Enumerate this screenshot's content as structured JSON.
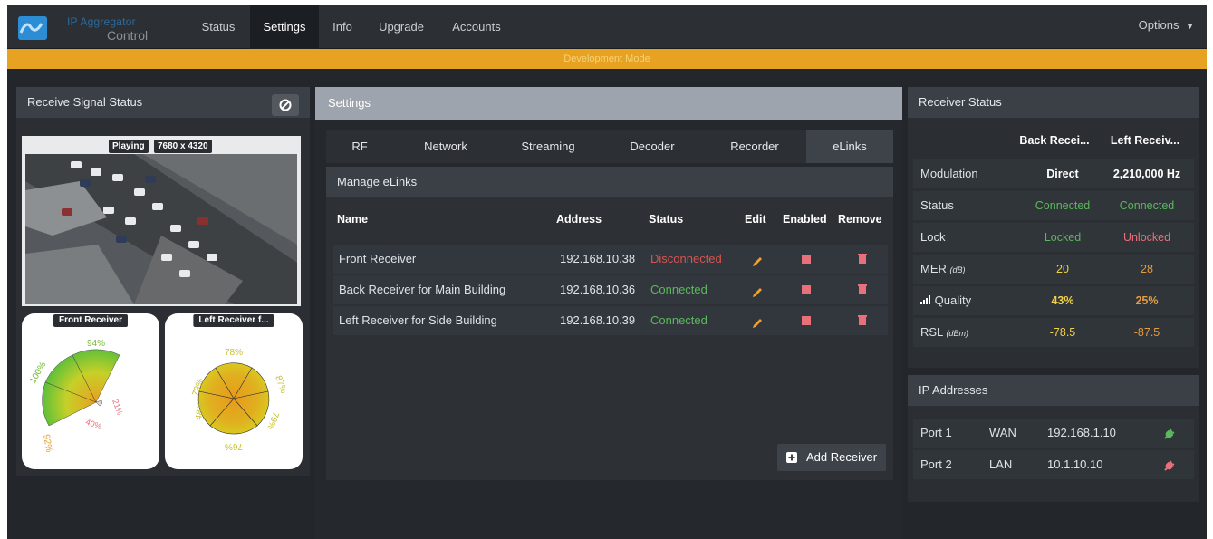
{
  "app": {
    "brand_line1": "IP Aggregator",
    "brand_line2": "Control",
    "nav": [
      "Status",
      "Settings",
      "Info",
      "Upgrade",
      "Accounts"
    ],
    "active_nav": "Settings",
    "options_label": "Options",
    "mode_banner": "Development Mode"
  },
  "receive_signal": {
    "title": "Receive Signal Status",
    "playing_label": "Playing",
    "resolution": "7680 x 4320",
    "cards": [
      {
        "title": "Front Receiver",
        "labels": [
          "94%",
          "100%",
          "21%",
          "40%",
          "92%"
        ]
      },
      {
        "title": "Left Receiver f...",
        "labels": [
          "78%",
          "87%",
          "79%",
          "48%",
          "79%",
          "76%"
        ]
      }
    ]
  },
  "settings": {
    "title": "Settings",
    "tabs": [
      "RF",
      "Network",
      "Streaming",
      "Decoder",
      "Recorder",
      "eLinks"
    ],
    "active_tab": "eLinks",
    "manage_title": "Manage eLinks",
    "columns": [
      "Name",
      "Address",
      "Status",
      "Edit",
      "Enabled",
      "Remove"
    ],
    "rows": [
      {
        "name": "Front Receiver",
        "address": "192.168.10.38",
        "status": "Disconnected",
        "status_color": "#d9534f"
      },
      {
        "name": "Back Receiver for Main Building",
        "address": "192.168.10.36",
        "status": "Connected",
        "status_color": "#5cb85c"
      },
      {
        "name": "Left Receiver for Side Building",
        "address": "192.168.10.39",
        "status": "Connected",
        "status_color": "#5cb85c"
      }
    ],
    "add_button": "Add Receiver"
  },
  "receiver_status": {
    "title": "Receiver Status",
    "col1": "Back Recei...",
    "col2": "Left Receiv...",
    "rows": [
      {
        "label": "Modulation",
        "unit": "",
        "v1": "Direct",
        "v2": "2,210,000 Hz"
      },
      {
        "label": "Status",
        "unit": "",
        "v1": "Connected",
        "v2": "Connected"
      },
      {
        "label": "Lock",
        "unit": "",
        "v1": "Locked",
        "v2": "Unlocked"
      },
      {
        "label": "MER",
        "unit": "(dB)",
        "v1": "20",
        "v2": "28"
      },
      {
        "label": "Quality",
        "unit": "",
        "v1": "43%",
        "v2": "25%"
      },
      {
        "label": "RSL",
        "unit": "(dBm)",
        "v1": "-78.5",
        "v2": "-87.5"
      }
    ]
  },
  "ip_addresses": {
    "title": "IP Addresses",
    "ports": [
      {
        "port": "Port 1",
        "type": "WAN",
        "ip": "192.168.1.10",
        "plug_color": "#5cb85c"
      },
      {
        "port": "Port 2",
        "type": "LAN",
        "ip": "10.1.10.10",
        "plug_color": "#e8707a"
      }
    ]
  },
  "colors": {
    "accent_blue": "#1f7fc4",
    "dev_banner": "#e8a221",
    "success": "#5cb85c",
    "danger": "#d9534f",
    "warning_yellow": "#f0d24a"
  }
}
